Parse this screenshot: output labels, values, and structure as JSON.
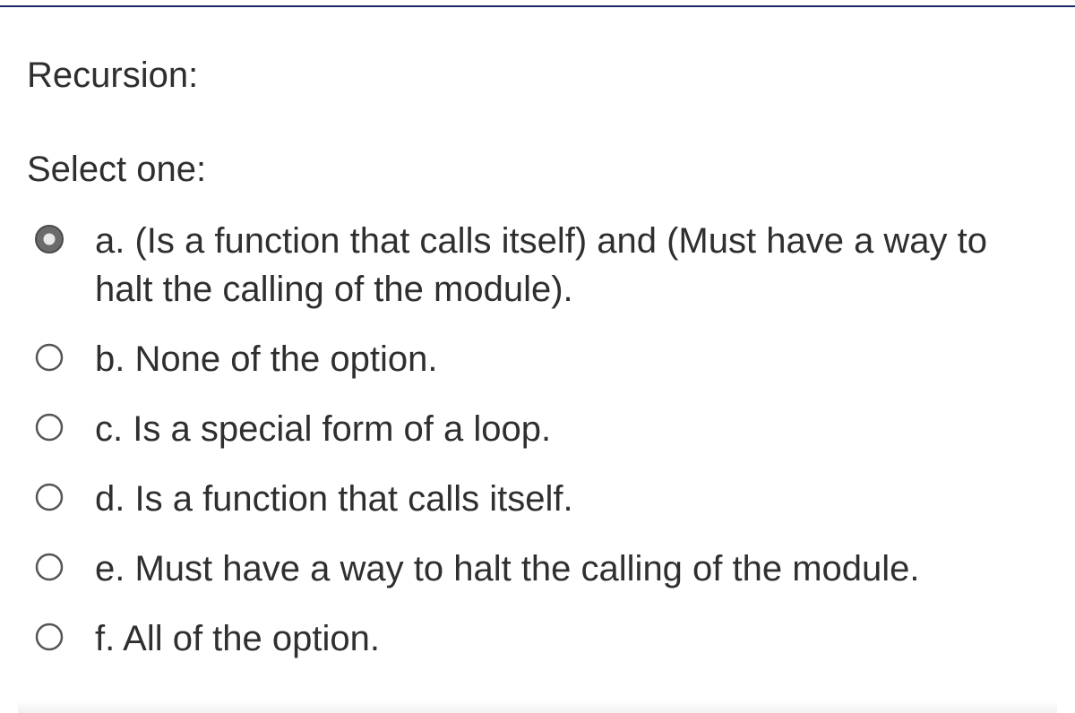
{
  "question": {
    "title": "Recursion:",
    "prompt": "Select one:",
    "selected_index": 0,
    "options": [
      {
        "letter": "a",
        "text": "(Is a function that calls itself) and (Must have a way to halt the calling of the module)."
      },
      {
        "letter": "b",
        "text": "None of the option."
      },
      {
        "letter": "c",
        "text": "Is a special form of a loop."
      },
      {
        "letter": "d",
        "text": "Is a function that calls itself."
      },
      {
        "letter": "e",
        "text": "Must have a way to halt the calling of the module."
      },
      {
        "letter": "f",
        "text": "All of the option."
      }
    ]
  }
}
